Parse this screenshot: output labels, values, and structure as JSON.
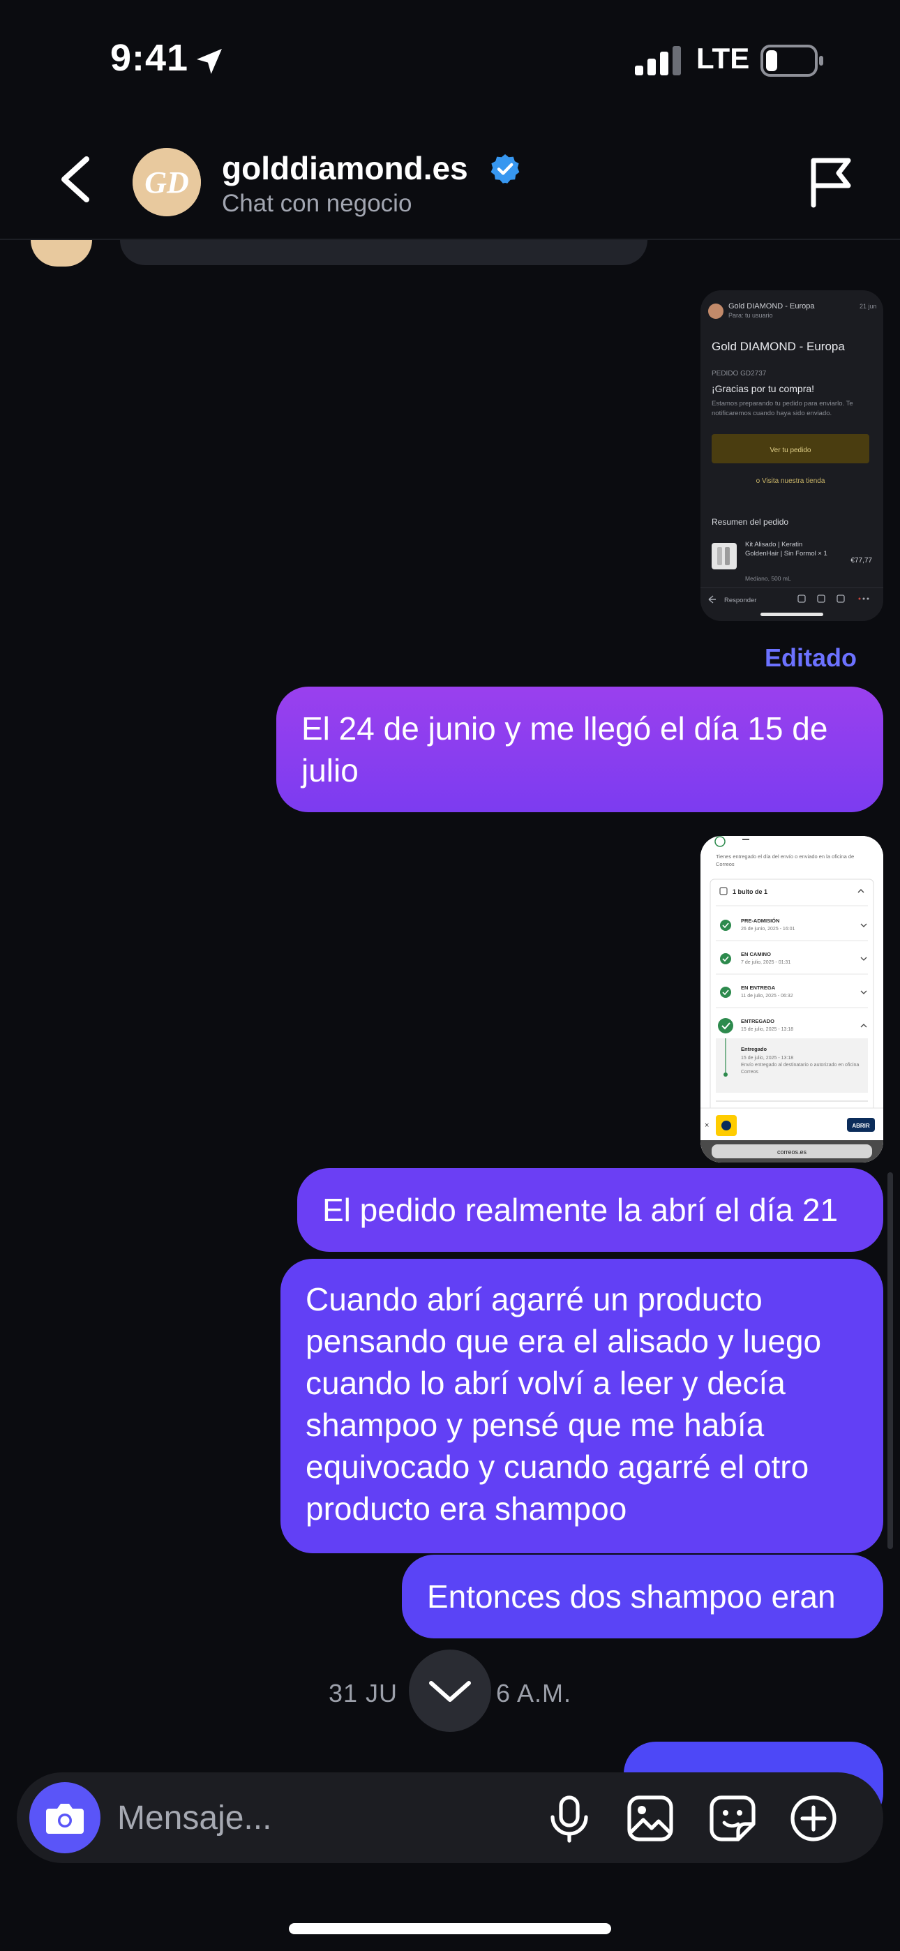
{
  "status_bar": {
    "time": "9:41",
    "network": "LTE"
  },
  "header": {
    "business_name": "golddiamond.es",
    "subtitle": "Chat con negocio",
    "avatar_initials": "GD"
  },
  "shot1": {
    "sender": "Gold DIAMOND - Europa",
    "to": "Para: tu usuario",
    "date": "21 jun",
    "title": "Gold DIAMOND - Europa",
    "order": "PEDIDO GD2737",
    "thanks": "¡Gracias por tu compra!",
    "body": "Estamos preparando tu pedido para enviarlo. Te notificaremos cuando haya sido enviado.",
    "view_order": "Ver tu pedido",
    "visit_store": "o Visita nuestra tienda",
    "summary": "Resumen del pedido",
    "item": "Kit Alisado | Keratin GoldenHair | Sin Formol × 1",
    "item_size": "Mediano, 500 mL",
    "price": "€77,77",
    "reply": "Responder"
  },
  "shot2": {
    "top_text": "Tienes entregado el día del envío o enviado en la oficina de Correos",
    "package": "1 bulto de 1",
    "steps": [
      {
        "label": "PRE-ADMISIÓN",
        "date": "26 de junio, 2025 - 16:01"
      },
      {
        "label": "EN CAMINO",
        "date": "7 de julio, 2025 - 01:31"
      },
      {
        "label": "EN ENTREGA",
        "date": "11 de julio, 2025 - 06:32"
      },
      {
        "label": "ENTREGADO",
        "date": "15 de julio, 2025 - 13:18"
      }
    ],
    "detail_title": "Entregado",
    "detail_date": "15 de julio, 2025 - 13:18",
    "detail_body": "Envío entregado al destinatario o autorizado en oficina Correos",
    "open_btn": "ABRIR",
    "url": "correos.es"
  },
  "messages": {
    "edited": "Editado",
    "m1": "El 24 de junio y me llegó el día 15 de julio",
    "m2": "El pedido realmente la abrí el día 21",
    "m3": "Cuando abrí agarré un producto pensando que era el alisado y luego cuando lo abrí volví a leer y decía shampoo y pensé que me había equivocado y cuando agarré el otro producto era shampoo",
    "m4": "Entonces dos shampoo eran",
    "date_separator": "31 JU     6 A.M."
  },
  "composer": {
    "placeholder": "Mensaje..."
  },
  "icons": {
    "back": "chevron-left-icon",
    "flag": "flag-icon",
    "verified": "verified-badge-icon",
    "camera": "camera-icon",
    "mic": "microphone-icon",
    "gallery": "image-icon",
    "sticker": "sticker-icon",
    "plus": "plus-circle-icon",
    "scroll": "chevron-down-icon"
  },
  "colors": {
    "background": "#0b0c10",
    "accent": "#5a55f8",
    "edited_label": "#6c72ff",
    "verified": "#3797f0"
  }
}
